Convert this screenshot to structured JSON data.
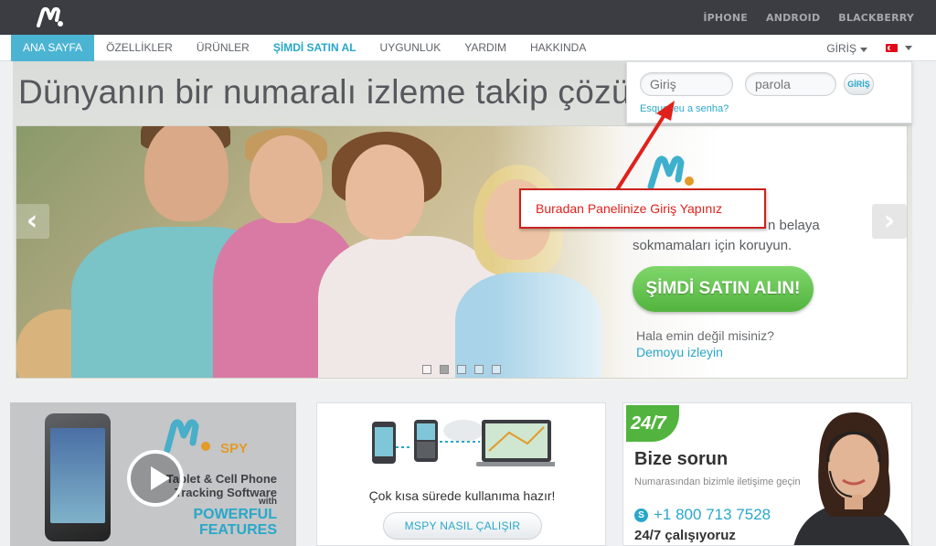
{
  "header": {
    "platforms": [
      "İPHONE",
      "ANDROID",
      "BLACKBERRY"
    ]
  },
  "nav": {
    "items": [
      {
        "label": "ANA SAYFA"
      },
      {
        "label": "ÖZELLİKLER"
      },
      {
        "label": "ÜRÜNLER"
      },
      {
        "label": "ŞİMDİ SATIN AL"
      },
      {
        "label": "UYGUNLUK"
      },
      {
        "label": "YARDIM"
      },
      {
        "label": "HAKKINDA"
      }
    ],
    "login_label": "GİRİŞ",
    "active_color": "#4cb4d3",
    "accent_color": "#29a7c9"
  },
  "login": {
    "user_placeholder": "Giriş",
    "pass_placeholder": "parola",
    "button_label": "GİRİŞ",
    "forgot_link": "Esqueceu a senha?"
  },
  "hero": {
    "title": "Dünyanın bir numaralı izleme takip çözü",
    "text_line1": "n belaya",
    "text_line2": "sokmamaları için koruyun.",
    "buy_button": "ŞİMDİ SATIN ALIN!",
    "unsure_text": "Hala emin değil misiniz?",
    "demo_link": "Demoyu izleyin",
    "slide_count": 5,
    "active_slide": 2
  },
  "annotation": {
    "text": "Buradan Panelinize Giriş Yapınız"
  },
  "cards": {
    "video": {
      "spy_label": "SPY",
      "line1": "Tablet & Cell Phone",
      "line2": "Tracking Software",
      "line3": "with",
      "features1": "POWERFUL",
      "features2": "FEATURES"
    },
    "howto": {
      "text": "Çok kısa sürede kullanıma hazır!",
      "button": "MSPY NASIL ÇALIŞIR"
    },
    "support": {
      "badge": "24/7",
      "title": "Bize sorun",
      "subtitle": "Numarasından bizimle iletişime geçin",
      "phone": "+1 800 713 7528",
      "hours": "24/7 çalışıyoruz"
    }
  }
}
